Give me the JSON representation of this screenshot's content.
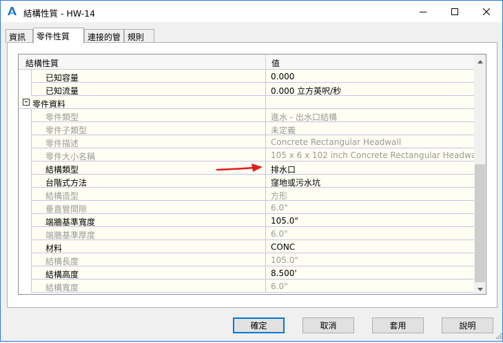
{
  "window": {
    "title": "結構性質 - HW-14",
    "icons": {
      "app": "autodesk-a-icon",
      "minimize": "minimize-icon",
      "maximize": "maximize-icon",
      "close": "close-icon"
    }
  },
  "tabs": [
    {
      "label": "資訊",
      "active": false
    },
    {
      "label": "零件性質",
      "active": true
    },
    {
      "label": "連接的管",
      "active": false
    },
    {
      "label": "規則",
      "active": false
    }
  ],
  "grid": {
    "headers": {
      "name": "結構性質",
      "value": "值"
    },
    "rows": [
      {
        "name": "已知容量",
        "value": "0.000",
        "disabled": false
      },
      {
        "name": "已知流量",
        "value": "0.000 立方英呎/秒",
        "disabled": false
      },
      {
        "name": "零件資料",
        "value": "",
        "group": true
      },
      {
        "name": "零件類型",
        "value": "進水 - 出水口結構",
        "disabled": true
      },
      {
        "name": "零件子類型",
        "value": "未定義",
        "disabled": true
      },
      {
        "name": "零件描述",
        "value": "Concrete Rectangular Headwall",
        "disabled": true
      },
      {
        "name": "零件大小名稱",
        "value": "105 x 6 x 102 inch Concrete Rectangular Headwall",
        "disabled": true
      },
      {
        "name": "結構類型",
        "value": "排水口",
        "disabled": false
      },
      {
        "name": "台階式方法",
        "value": "窪地或污水坑",
        "disabled": false
      },
      {
        "name": "結構造型",
        "value": "方形",
        "disabled": true
      },
      {
        "name": "垂直管間隙",
        "value": "6.0\"",
        "disabled": true
      },
      {
        "name": "端牆基準寬度",
        "value": "105.0\"",
        "disabled": false
      },
      {
        "name": "端牆基準厚度",
        "value": "6.0\"",
        "disabled": true
      },
      {
        "name": "材料",
        "value": "CONC",
        "disabled": false
      },
      {
        "name": "結構長度",
        "value": "105.0\"",
        "disabled": true
      },
      {
        "name": "結構高度",
        "value": "8.500'",
        "disabled": false
      },
      {
        "name": "結構寬度",
        "value": "6.0\"",
        "disabled": true
      }
    ]
  },
  "buttons": {
    "ok": "確定",
    "cancel": "取消",
    "apply": "套用",
    "help": "說明"
  },
  "colors": {
    "row_bg": "#fefef2",
    "grid_line": "#c8c1e8",
    "accent": "#0078d7",
    "arrow": "#e02020"
  }
}
